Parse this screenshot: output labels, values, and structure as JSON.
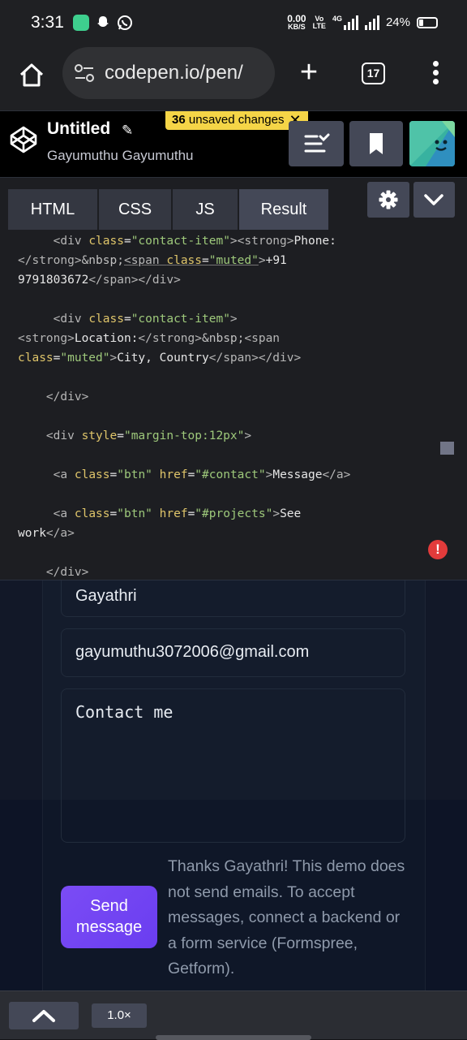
{
  "status_bar": {
    "time": "3:31",
    "net_speed_value": "0.00",
    "net_speed_unit": "KB/S",
    "volte_top": "Vo",
    "volte_bottom": "LTE",
    "network": "4G",
    "battery": "24%"
  },
  "browser": {
    "url": "codepen.io/pen/",
    "tab_count": "17"
  },
  "codepen": {
    "title": "Untitled",
    "author": "Gayumuthu Gayumuthu",
    "unsaved_count": "36",
    "unsaved_text": "unsaved changes",
    "tabs": [
      "HTML",
      "CSS",
      "JS",
      "Result"
    ]
  },
  "result": {
    "name_value": "Gayathri",
    "email_value": "gayumuthu3072006@gmail.com",
    "message_value": "Contact me",
    "send_label_line1": "Send",
    "send_label_line2": "message",
    "note": "Thanks Gayathri! This demo does not send emails. To accept messages, connect a backend or a form service (Formspree, Getform)."
  },
  "bottom_bar": {
    "zoom": "1.0×"
  },
  "colors": {
    "unsaved_badge": "#f5d547",
    "send_button": "#7b4cf5",
    "error_badge": "#e23b3b"
  }
}
